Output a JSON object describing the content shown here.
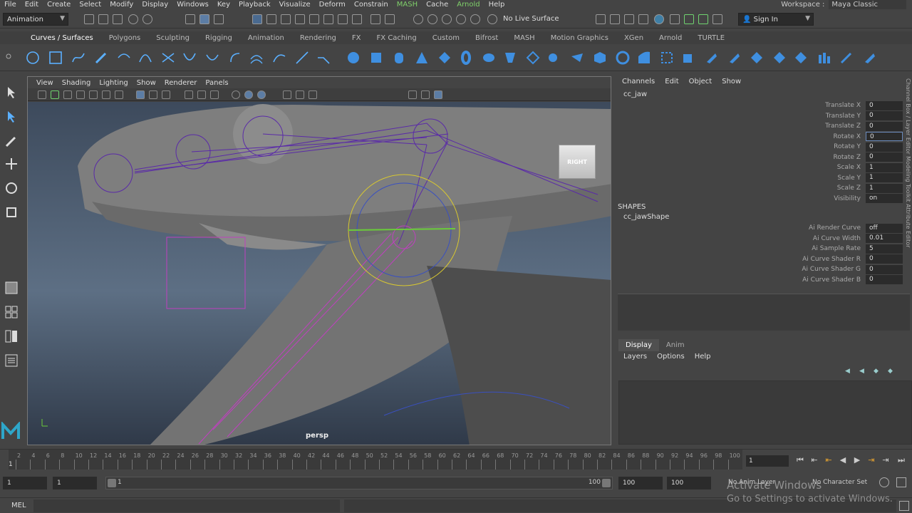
{
  "menubar": [
    "File",
    "Edit",
    "Create",
    "Select",
    "Modify",
    "Display",
    "Windows",
    "Key",
    "Playback",
    "Visualize",
    "Deform",
    "Constrain",
    "MASH",
    "Cache",
    "Arnold",
    "Help"
  ],
  "menubar_green": [
    "MASH",
    "Arnold"
  ],
  "workspace": {
    "label": "Workspace :",
    "value": "Maya Classic"
  },
  "status": {
    "mode": "Animation",
    "live_surface": "No Live Surface",
    "sign_in": "Sign In"
  },
  "shelf_tabs": [
    "Curves / Surfaces",
    "Polygons",
    "Sculpting",
    "Rigging",
    "Animation",
    "Rendering",
    "FX",
    "FX Caching",
    "Custom",
    "Bifrost",
    "MASH",
    "Motion Graphics",
    "XGen",
    "Arnold",
    "TURTLE"
  ],
  "active_shelf": "Curves / Surfaces",
  "viewport": {
    "menu": [
      "View",
      "Shading",
      "Lighting",
      "Show",
      "Renderer",
      "Panels"
    ],
    "camera_label": "persp",
    "viewcube_label": "RIGHT"
  },
  "channel_box": {
    "menu": [
      "Channels",
      "Edit",
      "Object",
      "Show"
    ],
    "node": "cc_jaw",
    "attributes": [
      {
        "name": "Translate X",
        "value": "0"
      },
      {
        "name": "Translate Y",
        "value": "0"
      },
      {
        "name": "Translate Z",
        "value": "0"
      },
      {
        "name": "Rotate X",
        "value": "0"
      },
      {
        "name": "Rotate Y",
        "value": "0"
      },
      {
        "name": "Rotate Z",
        "value": "0"
      },
      {
        "name": "Scale X",
        "value": "1"
      },
      {
        "name": "Scale Y",
        "value": "1"
      },
      {
        "name": "Scale Z",
        "value": "1"
      },
      {
        "name": "Visibility",
        "value": "on"
      }
    ],
    "shapes_header": "SHAPES",
    "shape_node": "cc_jawShape",
    "shape_attributes": [
      {
        "name": "Ai Render Curve",
        "value": "off"
      },
      {
        "name": "Ai Curve Width",
        "value": "0.01"
      },
      {
        "name": "Ai Sample Rate",
        "value": "5"
      },
      {
        "name": "Ai Curve Shader R",
        "value": "0"
      },
      {
        "name": "Ai Curve Shader G",
        "value": "0"
      },
      {
        "name": "Ai Curve Shader B",
        "value": "0"
      }
    ]
  },
  "side_strip": "Channel Box / Layer Editor    Modeling Toolkit    Attribute Editor",
  "layer_editor": {
    "tabs": [
      "Display",
      "Anim"
    ],
    "menu": [
      "Layers",
      "Options",
      "Help"
    ]
  },
  "timeline": {
    "ticks": [
      "2",
      "4",
      "6",
      "8",
      "10",
      "12",
      "14",
      "16",
      "18",
      "20",
      "22",
      "24",
      "26",
      "28",
      "30",
      "32",
      "34",
      "36",
      "38",
      "40",
      "42",
      "44",
      "46",
      "48",
      "50",
      "52",
      "54",
      "56",
      "58",
      "60",
      "62",
      "64",
      "66",
      "68",
      "70",
      "72",
      "74",
      "76",
      "78",
      "80",
      "82",
      "84",
      "86",
      "88",
      "90",
      "92",
      "94",
      "96",
      "98",
      "100"
    ],
    "current_frame": "1",
    "start_marker": "1"
  },
  "range": {
    "start": "1",
    "playback_start": "1",
    "bar_start": "1",
    "bar_end": "100",
    "playback_end": "100",
    "end": "100",
    "anim_layer": "No Anim Layer",
    "character_set": "No Character Set"
  },
  "cmdline": {
    "label": "MEL"
  },
  "watermark": {
    "title": "Activate Windows",
    "subtitle": "Go to Settings to activate Windows."
  }
}
